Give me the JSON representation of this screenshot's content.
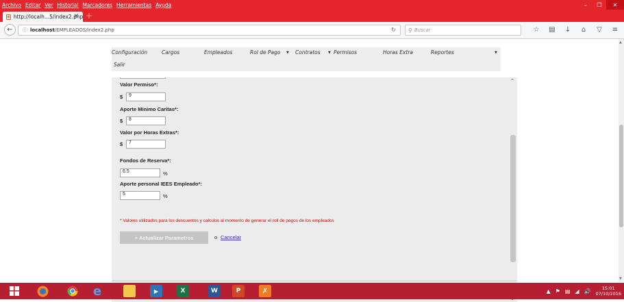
{
  "browser": {
    "menu": [
      "Archivo",
      "Editar",
      "Ver",
      "Historial",
      "Marcadores",
      "Herramientas",
      "Ayuda"
    ],
    "tab_title": "http://localh...5/index2.php",
    "url_host": "localhost",
    "url_path": "/EMPLEADOS/index2.php",
    "search_placeholder": "Buscar",
    "accent_color": "#e2262c"
  },
  "app_nav": {
    "items": [
      {
        "label": "Configuración",
        "dropdown": false
      },
      {
        "label": "Cargos",
        "dropdown": false
      },
      {
        "label": "Empleados",
        "dropdown": false
      },
      {
        "label": "Rol de Pago",
        "dropdown": true
      },
      {
        "label": "Contratos",
        "dropdown": true
      },
      {
        "label": "Permisos",
        "dropdown": false
      },
      {
        "label": "Horas Extra",
        "dropdown": false
      },
      {
        "label": "Reportes",
        "dropdown": true
      },
      {
        "label": "Salir",
        "dropdown": false
      }
    ]
  },
  "form": {
    "valor_permiso": {
      "label": "Valor Permiso*:",
      "prefix": "$",
      "value": "9"
    },
    "aporte_caritas": {
      "label": "Aporte Minimo Caritas*:",
      "prefix": "$",
      "value": "8"
    },
    "horas_extras": {
      "label": "Valor por Horas Extras*:",
      "prefix": "$",
      "value": "7"
    },
    "fondos_reserva": {
      "label": "Fondos de Reserva*:",
      "suffix": "%",
      "value": "6.5"
    },
    "aporte_iees": {
      "label": "Aporte personal IEES Empleado*:",
      "suffix": "%",
      "value": "5"
    },
    "note": "* Valores utilizados para los descuentos y calculos al momento de generar el roll de pagos de los empleados",
    "update_button": "+ Actualizar Parametros",
    "or_text": "o",
    "cancel_link": "Cancelar"
  },
  "taskbar": {
    "icons": [
      "windows-start",
      "firefox",
      "chrome",
      "internet-explorer",
      "file-explorer",
      "media-player",
      "excel",
      "word",
      "powerpoint",
      "xampp"
    ],
    "time": "15:01",
    "date": "07/10/2016"
  }
}
